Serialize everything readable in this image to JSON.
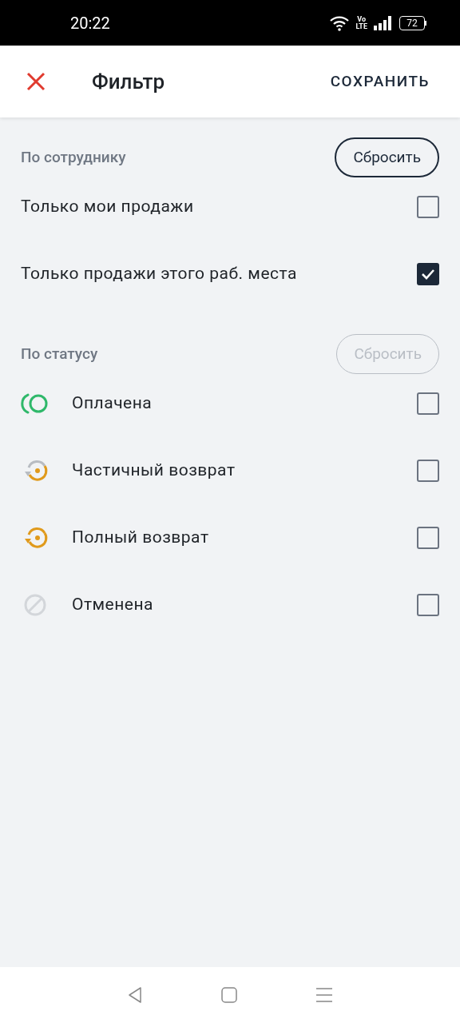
{
  "status_bar": {
    "time": "20:22",
    "volte_top": "Vo",
    "volte_bottom": "LTE",
    "battery": "72"
  },
  "header": {
    "title": "Фильтр",
    "action": "СОХРАНИТЬ"
  },
  "sections": [
    {
      "title": "По сотруднику",
      "reset": {
        "label": "Сбросить",
        "disabled": false
      },
      "items": [
        {
          "label": "Только мои продажи",
          "checked": false
        },
        {
          "label": "Только продажи этого раб. места",
          "checked": true
        }
      ]
    },
    {
      "title": "По статусу",
      "reset": {
        "label": "Сбросить",
        "disabled": true
      },
      "items": [
        {
          "kind": "paid",
          "label": "Оплачена",
          "checked": false
        },
        {
          "kind": "partial_refund",
          "label": "Частичный возврат",
          "checked": false
        },
        {
          "kind": "full_refund",
          "label": "Полный возврат",
          "checked": false
        },
        {
          "kind": "cancelled",
          "label": "Отменена",
          "checked": false
        }
      ]
    }
  ]
}
